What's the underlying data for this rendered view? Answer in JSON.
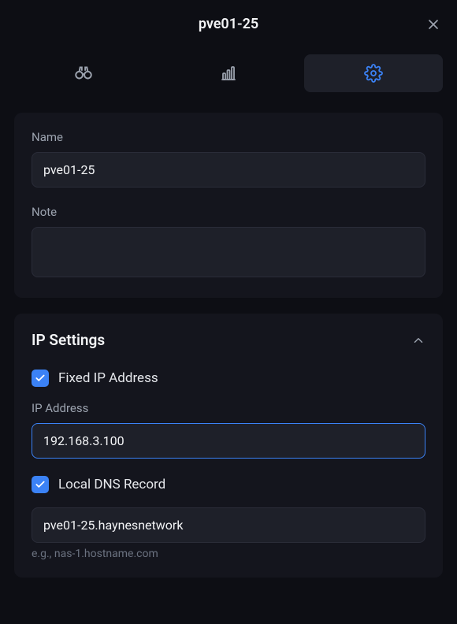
{
  "header": {
    "title": "pve01-25"
  },
  "tabs": {
    "overview": "binoculars",
    "stats": "bar-chart",
    "settings": "gear"
  },
  "form": {
    "name_label": "Name",
    "name_value": "pve01-25",
    "note_label": "Note",
    "note_value": ""
  },
  "ip": {
    "section_title": "IP Settings",
    "fixed_label": "Fixed IP Address",
    "address_label": "IP Address",
    "address_value": "192.168.3.100",
    "dns_label": "Local DNS Record",
    "dns_value": "pve01-25.haynesnetwork",
    "dns_hint": "e.g., nas-1.hostname.com"
  }
}
